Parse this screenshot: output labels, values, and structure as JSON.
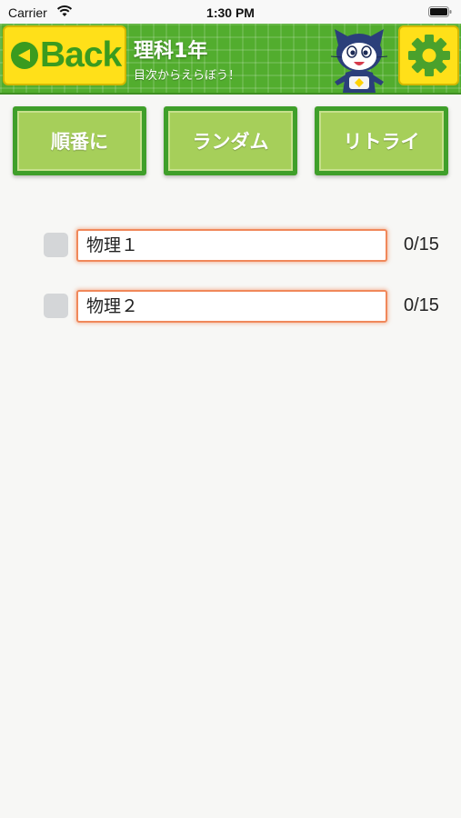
{
  "status_bar": {
    "carrier": "Carrier",
    "time": "1:30 PM"
  },
  "header": {
    "back_label": "Back",
    "title": "理科1年",
    "subtitle": "目次からえらぼう！",
    "settings_icon": "gear-icon",
    "colors": {
      "bar": "#52ad2e",
      "button": "#ffe019",
      "accent": "#3a9b1f"
    }
  },
  "mode_buttons": [
    {
      "label": "順番に"
    },
    {
      "label": "ランダム"
    },
    {
      "label": "リトライ"
    }
  ],
  "chapters": [
    {
      "name": "物理１",
      "score": "0/15",
      "checked": false
    },
    {
      "name": "物理２",
      "score": "0/15",
      "checked": false
    }
  ]
}
